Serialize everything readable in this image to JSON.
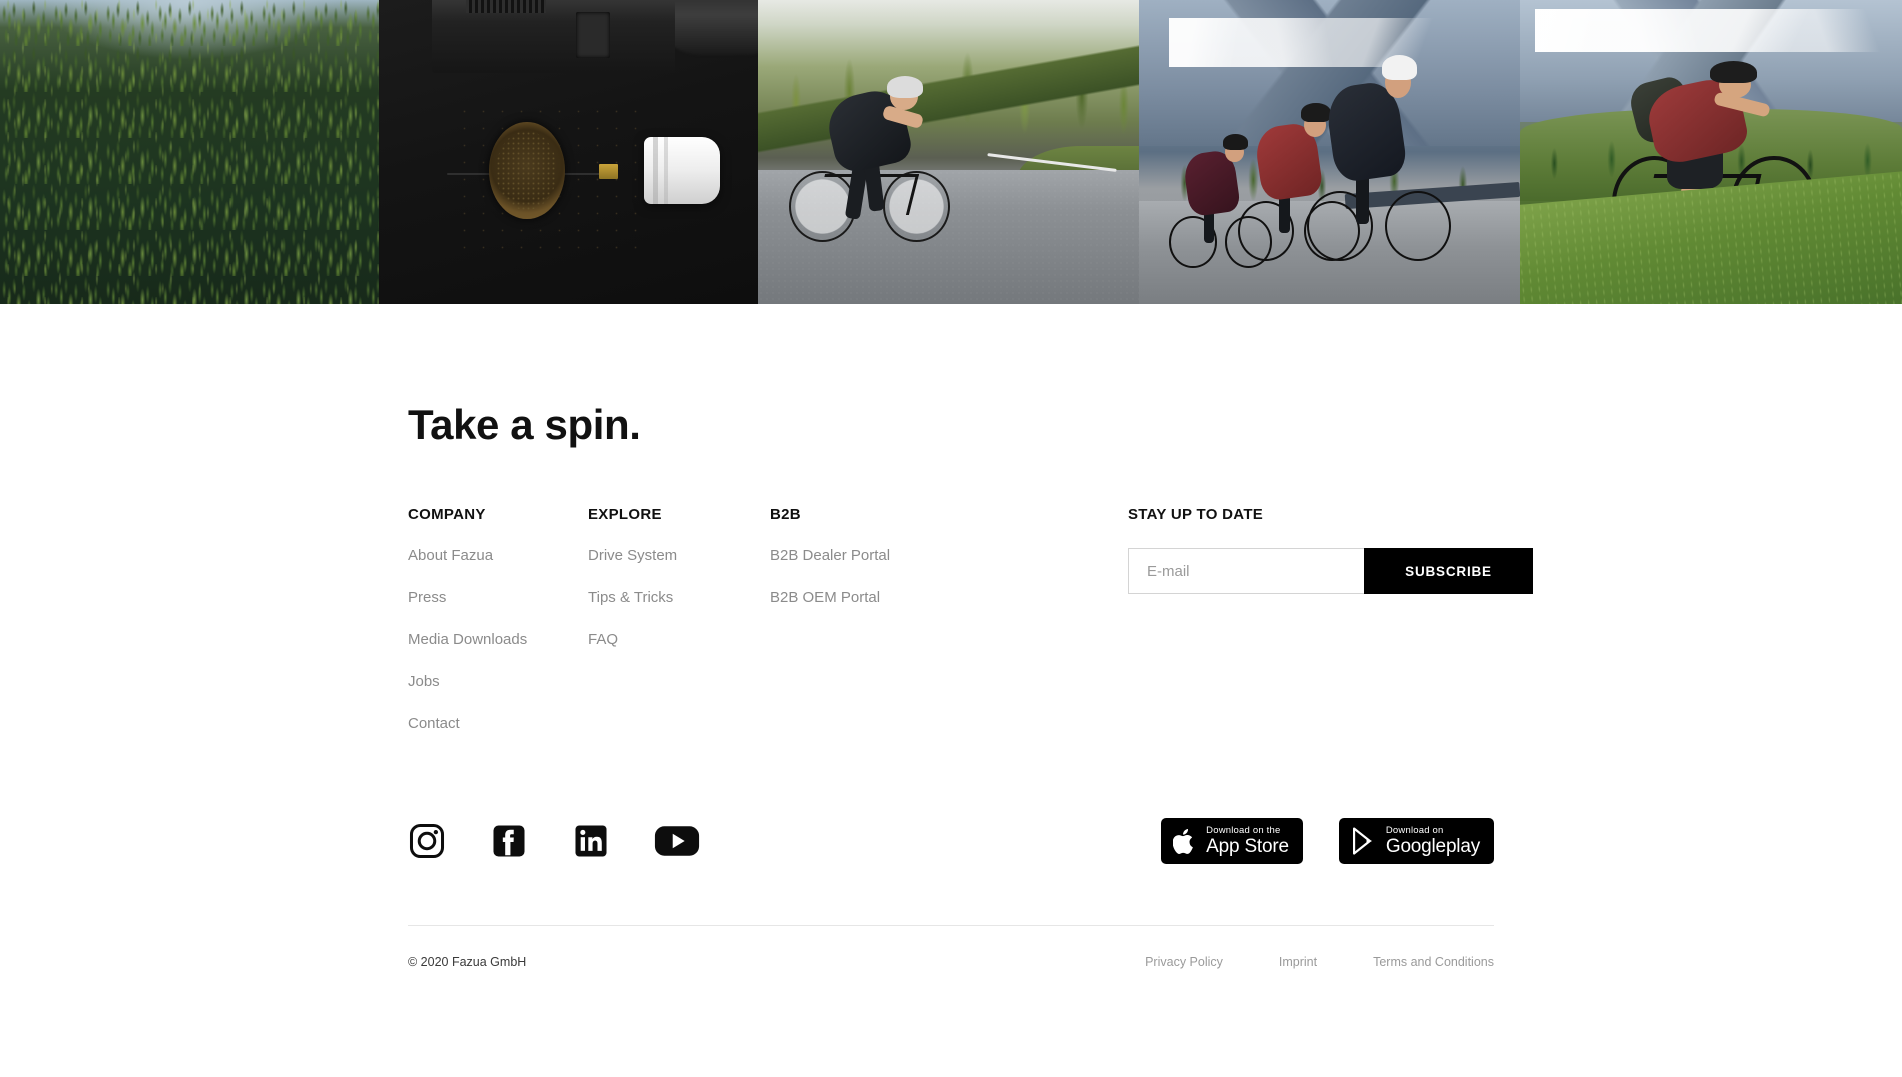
{
  "hero": {
    "panels": [
      {
        "name": "aerial-forest",
        "alt": "Aerial view of a coniferous forest"
      },
      {
        "name": "drive-system-flatlay",
        "alt": "Dark flatlay of e-bike drive components with bowl of pellets"
      },
      {
        "name": "road-cyclist-forest",
        "alt": "Road cyclist riding a mountain pass lined with pine trees"
      },
      {
        "name": "road-cyclist-group",
        "alt": "Group of road cyclists climbing with alpine mountains behind"
      },
      {
        "name": "mountain-biker-meadow",
        "alt": "Mountain biker riding across an alpine meadow"
      }
    ]
  },
  "footer": {
    "headline": "Take a spin.",
    "columns": [
      {
        "key": "company",
        "title": "COMPANY",
        "links": [
          "About Fazua",
          "Press",
          "Media Downloads",
          "Jobs",
          "Contact"
        ]
      },
      {
        "key": "explore",
        "title": "EXPLORE",
        "links": [
          "Drive System",
          "Tips & Tricks",
          "FAQ"
        ]
      },
      {
        "key": "b2b",
        "title": "B2B",
        "links": [
          "B2B Dealer Portal",
          "B2B OEM Portal"
        ]
      }
    ],
    "newsletter": {
      "title": "STAY UP TO DATE",
      "email_placeholder": "E-mail",
      "email_value": "",
      "subscribe_label": "SUBSCRIBE"
    },
    "social": [
      {
        "name": "instagram-icon",
        "label": "Instagram"
      },
      {
        "name": "facebook-icon",
        "label": "Facebook"
      },
      {
        "name": "linkedin-icon",
        "label": "LinkedIn"
      },
      {
        "name": "youtube-icon",
        "label": "YouTube"
      }
    ],
    "stores": {
      "apple": {
        "small": "Download on the",
        "big": "App Store"
      },
      "google": {
        "small": "Download on",
        "big_bold": "Google",
        "big_light": "play"
      }
    },
    "copyright": "© 2020 Fazua GmbH",
    "legal": [
      "Privacy Policy",
      "Imprint",
      "Terms and Conditions"
    ]
  },
  "colors": {
    "accent": "#000000",
    "text": "#111111",
    "muted": "#8b8b8b",
    "divider": "#e6e6e6"
  }
}
